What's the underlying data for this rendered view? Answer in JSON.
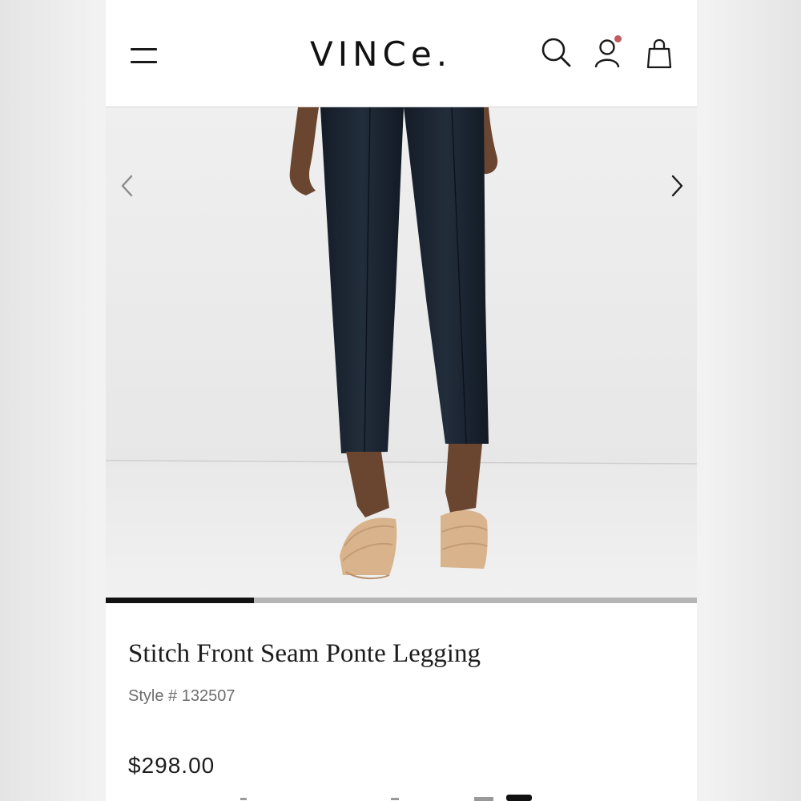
{
  "header": {
    "logo_text": "VINCe.",
    "icons": {
      "menu": "hamburger-menu-icon",
      "search": "search-icon",
      "account": "account-icon",
      "bag": "shopping-bag-icon"
    },
    "notification_dot_color": "#c25a5f"
  },
  "gallery": {
    "image_subject": "navy ponte legging with tan padded slide sandals",
    "current_progress": 0.25,
    "prev_icon": "chevron-left-icon",
    "next_icon": "chevron-right-icon"
  },
  "product": {
    "title": "Stitch Front Seam Ponte Legging",
    "style_number": "Style # 132507",
    "price": "$298.00"
  },
  "colors": {
    "text": "#1c1c1c",
    "muted": "#6d6d6d",
    "pants": "#1c2633",
    "sandal": "#d9b38c",
    "progress_fill": "#121212",
    "progress_track": "#b5b5b5"
  }
}
